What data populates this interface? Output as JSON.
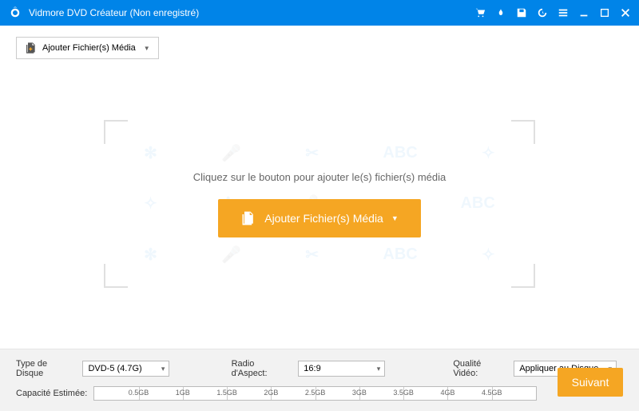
{
  "titlebar": {
    "title": "Vidmore DVD Créateur (Non enregistré)"
  },
  "toolbar": {
    "add_files_label": "Ajouter Fichier(s) Média"
  },
  "dropzone": {
    "hint": "Cliquez sur le bouton pour ajouter le(s) fichier(s) média",
    "button_label": "Ajouter Fichier(s) Média"
  },
  "footer": {
    "disc_type_label": "Type de Disque",
    "disc_type_value": "DVD-5 (4.7G)",
    "aspect_label": "Radio d'Aspect:",
    "aspect_value": "16:9",
    "quality_label": "Qualité Vidéo:",
    "quality_value": "Appliquer au Disque",
    "capacity_label": "Capacité Estimée:",
    "ticks": [
      "0.5GB",
      "1GB",
      "1.5GB",
      "2GB",
      "2.5GB",
      "3GB",
      "3.5GB",
      "4GB",
      "4.5GB"
    ],
    "next_label": "Suivant"
  }
}
